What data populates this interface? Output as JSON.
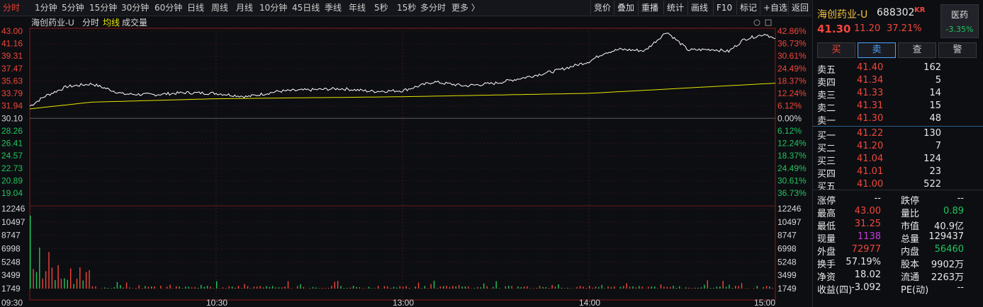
{
  "toolbar": {
    "periods": [
      "分时",
      "1分钟",
      "5分钟",
      "15分钟",
      "30分钟",
      "60分钟",
      "日线",
      "周线",
      "月线",
      "10分钟",
      "45日线",
      "季线",
      "年线",
      "5秒",
      "15秒",
      "多分时",
      "更多 〉"
    ],
    "active": "分时",
    "right_buttons": [
      "竞价",
      "叠加",
      "重播",
      "统计",
      "画线",
      "F10",
      "标记",
      "+自选",
      "返回"
    ]
  },
  "chart": {
    "title": "海创药业-U",
    "mode": "分时",
    "avg_label": "均线",
    "vol_label": "成交量",
    "price_ticks": [
      "43.00",
      "41.16",
      "39.31",
      "37.47",
      "35.63",
      "33.79",
      "31.94",
      "30.10",
      "28.26",
      "26.41",
      "24.57",
      "22.73",
      "20.89",
      "19.04"
    ],
    "pct_ticks": [
      "42.86%",
      "36.73%",
      "30.61%",
      "24.49%",
      "18.37%",
      "12.24%",
      "6.12%",
      "0.00%",
      "6.12%",
      "12.24%",
      "18.37%",
      "24.49%",
      "30.61%",
      "36.73%"
    ],
    "vol_ticks": [
      "12246",
      "10497",
      "8747",
      "6998",
      "5248",
      "3499",
      "1749"
    ],
    "time_ticks": [
      "09:30",
      "10:30",
      "13:00",
      "14:00",
      "15:00"
    ],
    "colors": {
      "up": "#f2463a",
      "down": "#22c55e",
      "price_line": "#ffffff",
      "avg_line": "#e6e600"
    }
  },
  "chart_data": {
    "type": "line",
    "x_range": [
      "09:30",
      "15:00"
    ],
    "ylim": [
      19.04,
      43.0
    ],
    "prev_close": 30.1,
    "series": [
      {
        "name": "",
        "x": [
          0,
          5,
          12,
          20,
          30,
          40,
          50,
          60,
          70,
          80,
          90,
          100,
          110,
          120,
          130,
          140,
          150,
          160,
          170,
          180,
          185,
          190,
          198,
          205,
          212,
          220,
          225,
          230,
          237,
          240
        ],
        "values": [
          31.9,
          33.4,
          34.8,
          35.2,
          33.7,
          33.6,
          33.9,
          33.8,
          33.3,
          34.1,
          34.3,
          34.5,
          34.1,
          34.2,
          35.5,
          34.9,
          35.3,
          36.2,
          37.2,
          38.5,
          39.8,
          40.3,
          40.1,
          42.9,
          40.2,
          40.3,
          40.0,
          41.8,
          42.6,
          41.7
        ]
      },
      {
        "name": "均线",
        "x": [
          0,
          20,
          60,
          120,
          180,
          240
        ],
        "values": [
          31.5,
          32.5,
          33.0,
          33.3,
          33.8,
          35.3
        ]
      }
    ],
    "volume_ylim": [
      0,
      12246
    ],
    "volume_peaks": [
      {
        "t": 0,
        "v": 11200
      },
      {
        "t": 3,
        "v": 6300
      },
      {
        "t": 6,
        "v": 5600
      },
      {
        "t": 9,
        "v": 3600
      }
    ]
  },
  "quote": {
    "name": "海创药业-U",
    "code": "688302",
    "tag": "KR",
    "sector": "医药",
    "sector_change": "-3.35%",
    "price": "41.30",
    "change": "11.20",
    "change_pct": "37.21%",
    "buttons": [
      "买",
      "卖",
      "查",
      "警"
    ],
    "asks": [
      {
        "label": "卖五",
        "price": "41.40",
        "vol": "162"
      },
      {
        "label": "卖四",
        "price": "41.34",
        "vol": "5"
      },
      {
        "label": "卖三",
        "price": "41.33",
        "vol": "14"
      },
      {
        "label": "卖二",
        "price": "41.31",
        "vol": "15"
      },
      {
        "label": "卖一",
        "price": "41.30",
        "vol": "48"
      }
    ],
    "bids": [
      {
        "label": "买一",
        "price": "41.22",
        "vol": "130"
      },
      {
        "label": "买二",
        "price": "41.20",
        "vol": "7"
      },
      {
        "label": "买三",
        "price": "41.04",
        "vol": "124"
      },
      {
        "label": "买四",
        "price": "41.01",
        "vol": "23"
      },
      {
        "label": "买五",
        "price": "41.00",
        "vol": "522"
      }
    ],
    "stats": [
      {
        "l1": "涨停",
        "v1": "--",
        "c1": "white",
        "l2": "跌停",
        "v2": "--",
        "c2": "white"
      },
      {
        "l1": "最高",
        "v1": "43.00",
        "c1": "red",
        "l2": "量比",
        "v2": "0.89",
        "c2": "green"
      },
      {
        "l1": "最低",
        "v1": "31.25",
        "c1": "red",
        "l2": "市值",
        "v2": "40.9亿",
        "c2": "white"
      },
      {
        "l1": "现量",
        "v1": "1138",
        "c1": "purple",
        "l2": "总量",
        "v2": "129437",
        "c2": "white"
      },
      {
        "l1": "外盘",
        "v1": "72977",
        "c1": "red",
        "l2": "内盘",
        "v2": "56460",
        "c2": "green"
      },
      {
        "l1": "换手",
        "v1": "57.19%",
        "c1": "white",
        "l2": "股本",
        "v2": "9902万",
        "c2": "white"
      },
      {
        "l1": "净资",
        "v1": "18.02",
        "c1": "white",
        "l2": "流通",
        "v2": "2263万",
        "c2": "white"
      },
      {
        "l1": "收益(四)",
        "v1": "-3.092",
        "c1": "white",
        "l2": "PE(动)",
        "v2": "--",
        "c2": "white"
      }
    ]
  }
}
